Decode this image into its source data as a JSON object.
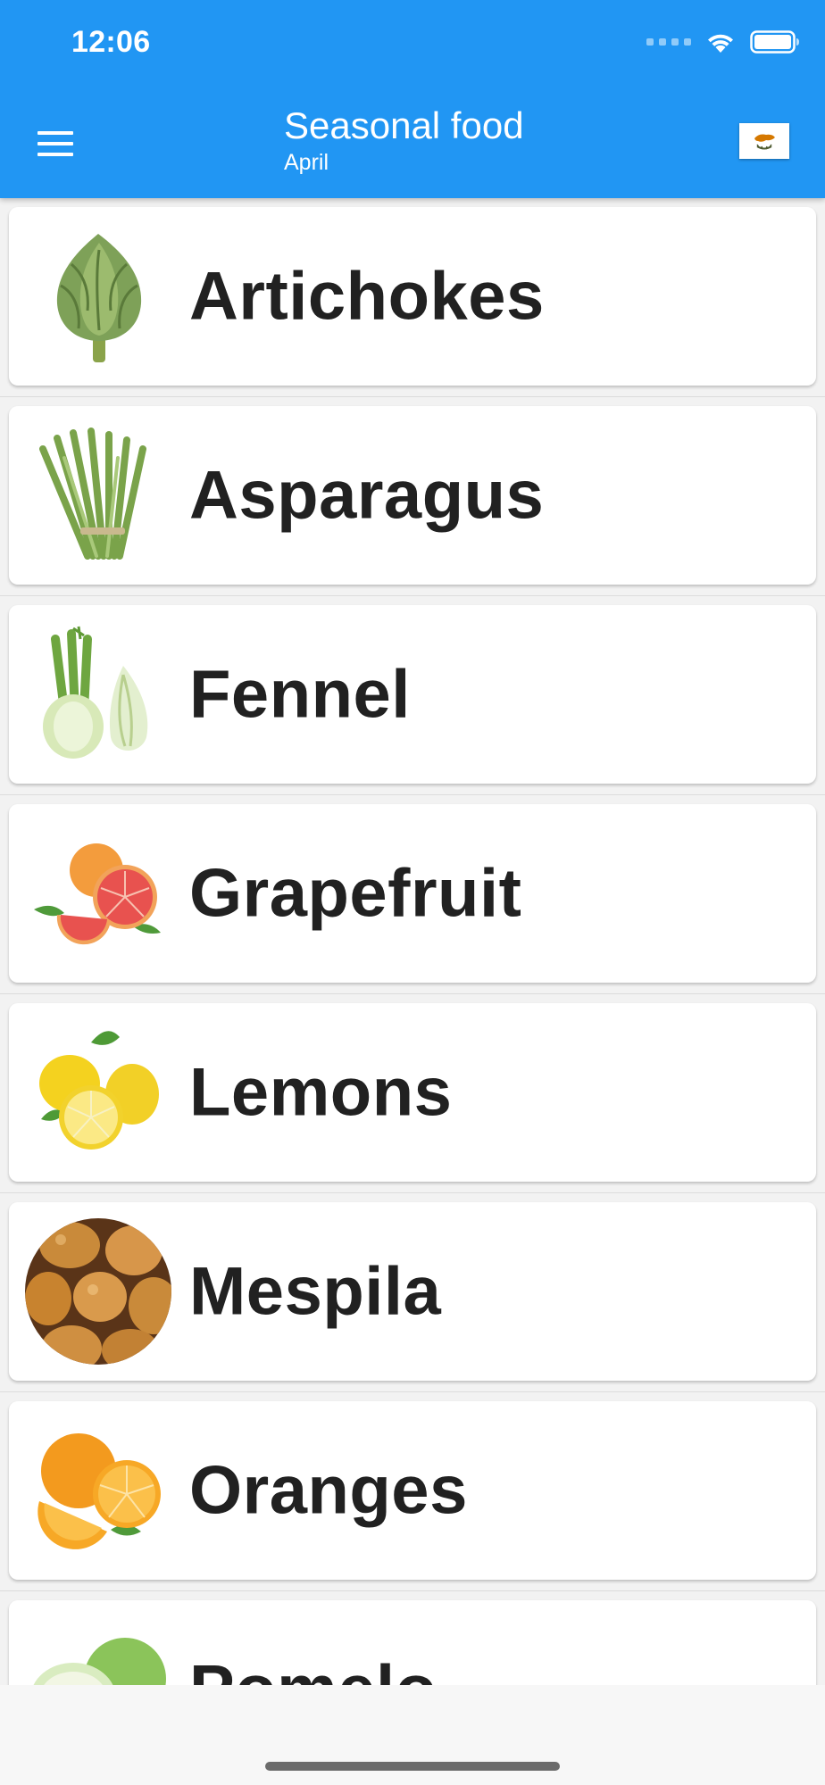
{
  "status_bar": {
    "time": "12:06",
    "icons": [
      "signal-icon",
      "wifi-icon",
      "battery-icon"
    ]
  },
  "app_bar": {
    "title": "Seasonal food",
    "subtitle": "April",
    "menu_icon": "hamburger-menu-icon",
    "flag_icon": "cyprus-flag-icon",
    "background_color": "#2196F3",
    "text_color": "#FFFFFF"
  },
  "items": [
    {
      "name": "Artichokes",
      "icon": "artichoke-icon"
    },
    {
      "name": "Asparagus",
      "icon": "asparagus-icon"
    },
    {
      "name": "Fennel",
      "icon": "fennel-icon"
    },
    {
      "name": "Grapefruit",
      "icon": "grapefruit-icon"
    },
    {
      "name": "Lemons",
      "icon": "lemon-icon"
    },
    {
      "name": "Mespila",
      "icon": "mespila-icon"
    },
    {
      "name": "Oranges",
      "icon": "orange-icon"
    },
    {
      "name": "Pomelo",
      "icon": "pomelo-icon"
    }
  ]
}
